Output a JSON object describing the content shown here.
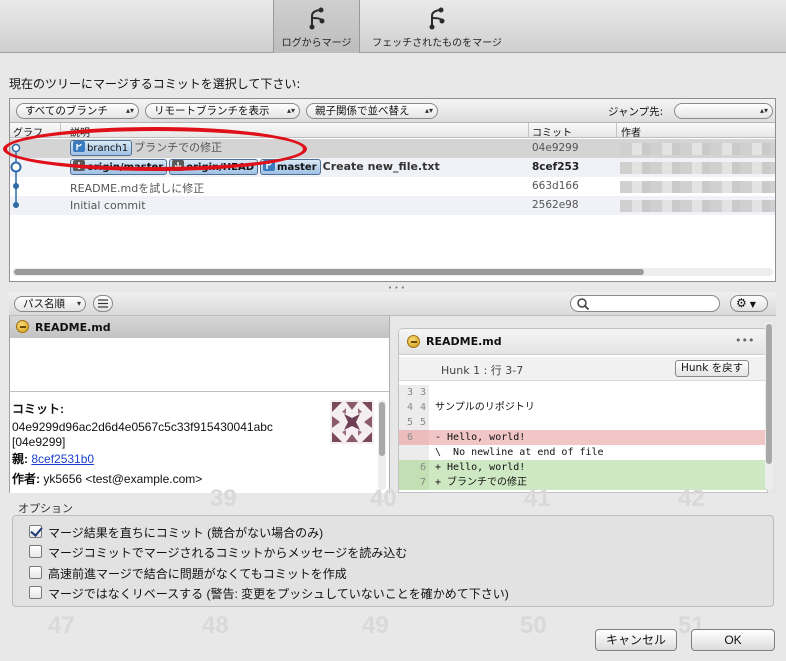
{
  "toolbar": {
    "merge_from_log": "ログからマージ",
    "merge_fetched": "フェッチされたものをマージ"
  },
  "prompt": "現在のツリーにマージするコミットを選択して下さい:",
  "filters": {
    "branches": "すべてのブランチ",
    "remote": "リモートブランチを表示",
    "sort": "親子関係で並べ替え",
    "jump_label": "ジャンプ先:",
    "jump_value": ""
  },
  "columns": {
    "graph": "グラフ",
    "description": "説明",
    "commit": "コミット",
    "author": "作者"
  },
  "commits": [
    {
      "labels": [
        "branch1"
      ],
      "desc": "ブランチでの修正",
      "hash": "04e9299",
      "bold": false,
      "selected": true
    },
    {
      "labels": [
        "origin/master",
        "origin/HEAD",
        "master"
      ],
      "desc": "Create new_file.txt",
      "hash": "8cef253",
      "bold": true,
      "selected": false
    },
    {
      "labels": [],
      "desc": "README.mdを試しに修正",
      "hash": "663d166",
      "bold": false,
      "selected": false
    },
    {
      "labels": [],
      "desc": "Initial commit",
      "hash": "2562e98",
      "bold": false,
      "selected": false
    }
  ],
  "file_bar": {
    "sort": "パス名順",
    "search_placeholder": ""
  },
  "file_list": [
    {
      "name": "README.md",
      "status": "modified"
    }
  ],
  "commit_info": {
    "commit_label": "コミット:",
    "hash_full": "04e9299d96ac2d6d4e0567c5c33f915430041abc",
    "hash_short": "[04e9299]",
    "parent_label": "親:",
    "parent_hash": "8cef2531b0",
    "author_label": "作者:",
    "author_value": "yk5656 <test@example.com>"
  },
  "diff": {
    "file": "README.md",
    "more": "•••",
    "hunk_title": "Hunk 1 : 行 3-7",
    "hunk_button": "Hunk を戻す",
    "lines": [
      {
        "type": "ctx",
        "n1": "3",
        "n2": "3",
        "text": ""
      },
      {
        "type": "ctx",
        "n1": "4",
        "n2": "4",
        "text": "サンプルのリポジトリ"
      },
      {
        "type": "ctx",
        "n1": "5",
        "n2": "5",
        "text": ""
      },
      {
        "type": "del",
        "n1": "6",
        "n2": "",
        "text": "- Hello, world!"
      },
      {
        "type": "ctx",
        "n1": "",
        "n2": "",
        "text": "\\  No newline at end of file"
      },
      {
        "type": "add",
        "n1": "",
        "n2": "6",
        "text": "+ Hello, world!"
      },
      {
        "type": "add",
        "n1": "",
        "n2": "7",
        "text": "+ ブランチでの修正"
      }
    ]
  },
  "options": {
    "title": "オプション",
    "items": [
      {
        "label": "マージ結果を直ちにコミット (競合がない場合のみ)",
        "checked": true
      },
      {
        "label": "マージコミットでマージされるコミットからメッセージを読み込む",
        "checked": false
      },
      {
        "label": "高速前進マージで結合に問題がなくてもコミットを作成",
        "checked": false
      },
      {
        "label": "マージではなくリベースする (警告: 変更をプッシュしていないことを確かめて下さい)",
        "checked": false
      }
    ]
  },
  "buttons": {
    "cancel": "キャンセル",
    "ok": "OK"
  },
  "background_numbers": [
    "39",
    "40",
    "41",
    "42",
    "47",
    "48",
    "49",
    "50",
    "51"
  ],
  "colors": {
    "badge": "#9fc1e4",
    "graph_line": "#2d6aa8",
    "highlight_ellipse": "#e0101a",
    "diff_del": "#f2c6c6",
    "diff_add": "#cfe8c4",
    "link": "#1a3fd1"
  }
}
